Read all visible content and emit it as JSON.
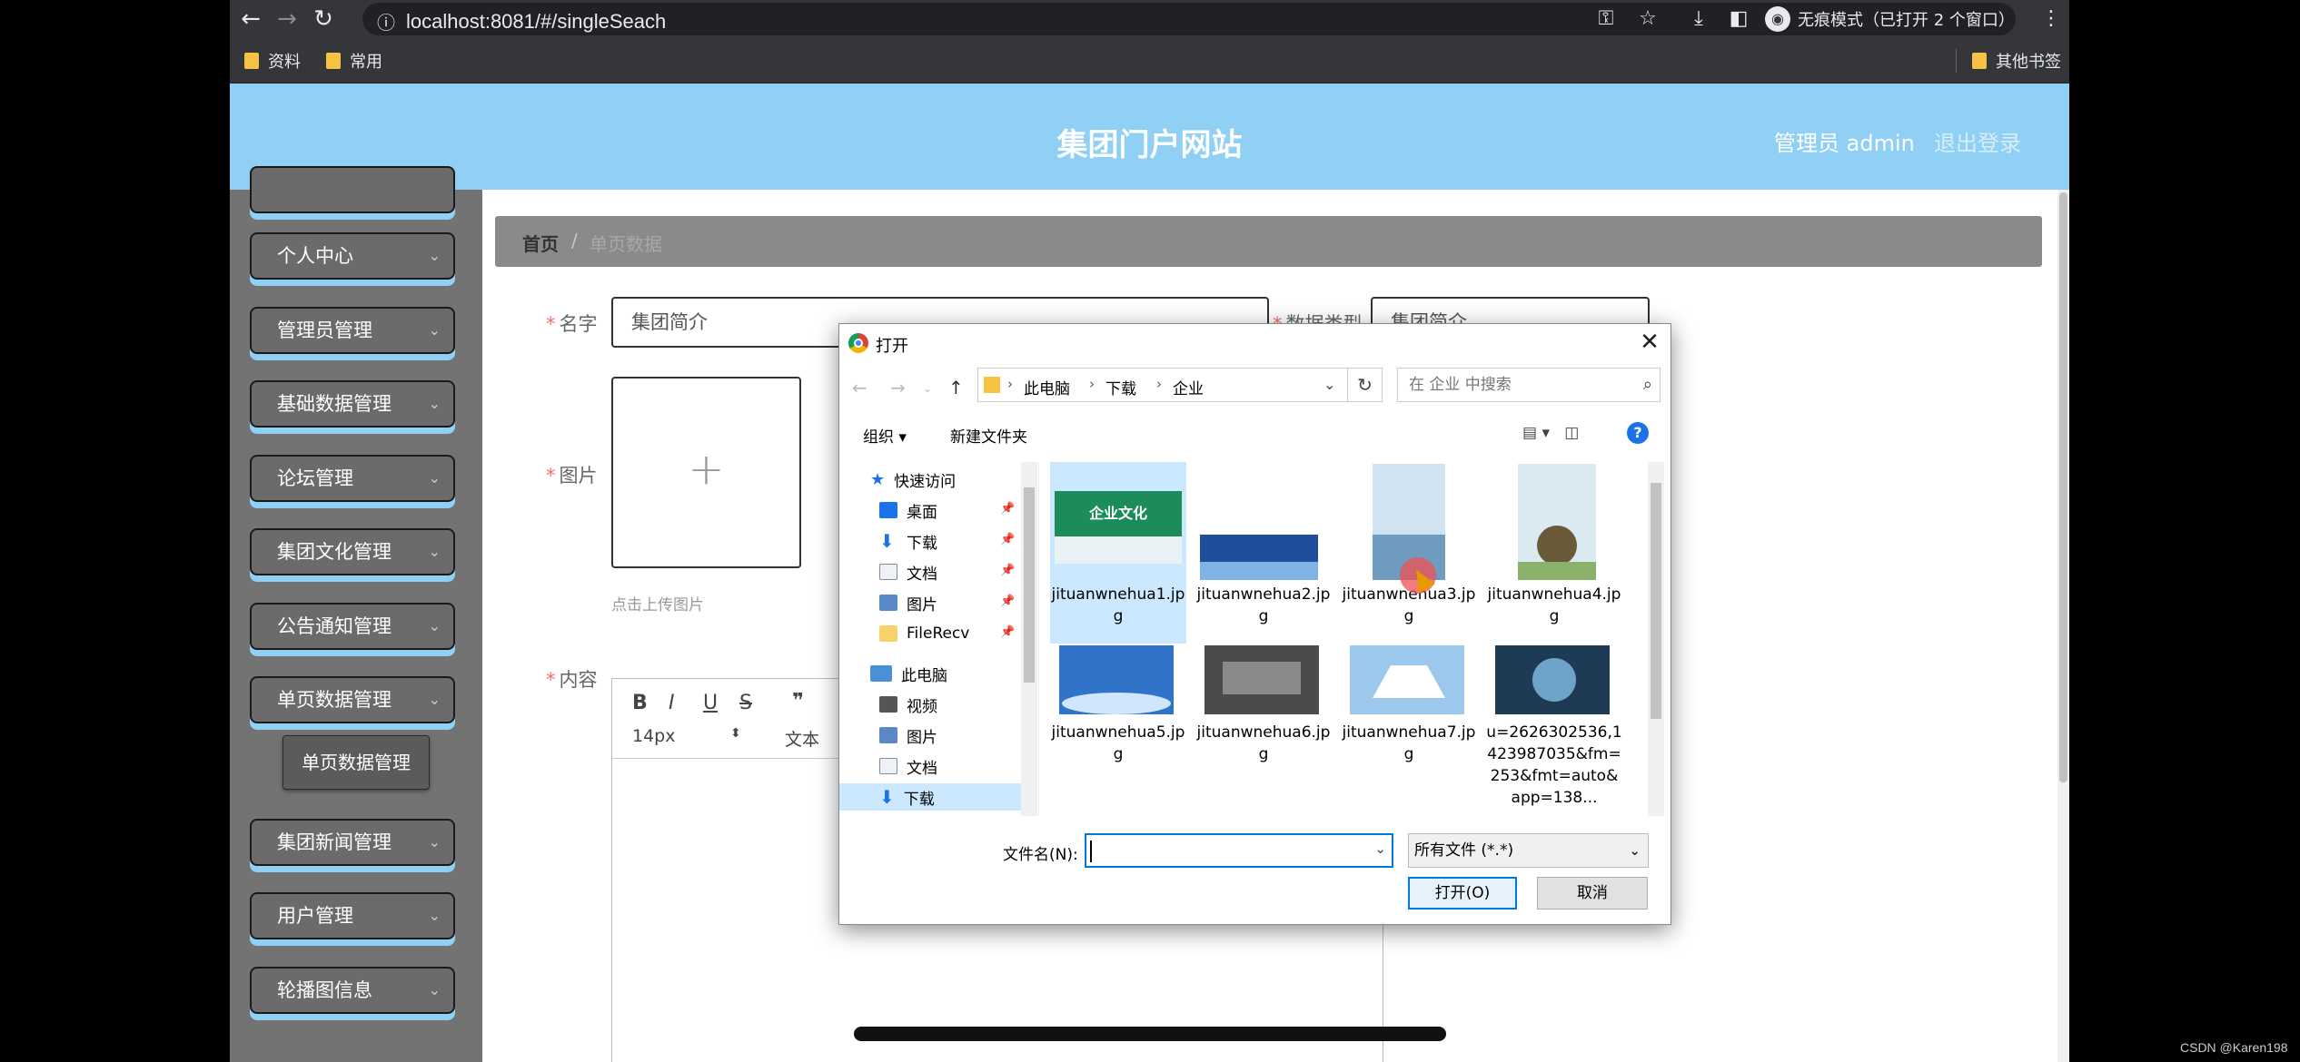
{
  "browser": {
    "url": "localhost:8081/#/singleSeach",
    "incognito_label": "无痕模式（已打开 2 个窗口）",
    "bookmarks": [
      "资料",
      "常用"
    ],
    "other_bookmarks": "其他书签"
  },
  "header": {
    "title": "集团门户网站",
    "admin_label": "管理员 admin",
    "logout_label": "退出登录"
  },
  "sidebar": {
    "items": [
      {
        "label": "个人中心"
      },
      {
        "label": "管理员管理"
      },
      {
        "label": "基础数据管理"
      },
      {
        "label": "论坛管理"
      },
      {
        "label": "集团文化管理"
      },
      {
        "label": "公告通知管理"
      },
      {
        "label": "单页数据管理"
      },
      {
        "label": "集团新闻管理"
      },
      {
        "label": "用户管理"
      },
      {
        "label": "轮播图信息"
      }
    ],
    "submenu_label": "单页数据管理"
  },
  "breadcrumb": {
    "home": "首页",
    "separator": "/",
    "current": "单页数据"
  },
  "form": {
    "name_label": "名字",
    "name_value": "集团简介",
    "type_label": "数据类型",
    "type_value": "集团简介",
    "image_label": "图片",
    "upload_hint": "点击上传图片",
    "content_label": "内容",
    "font_size": "14px",
    "text_style": "文本"
  },
  "dialog": {
    "title": "打开",
    "path": [
      "此电脑",
      "下载",
      "企业"
    ],
    "search_placeholder": "在 企业 中搜索",
    "organize": "组织 ▾",
    "new_folder": "新建文件夹",
    "tree": [
      {
        "label": "快速访问",
        "icon": "star-icon"
      },
      {
        "label": "桌面",
        "icon": "desktop-icon"
      },
      {
        "label": "下载",
        "icon": "download-icon"
      },
      {
        "label": "文档",
        "icon": "document-icon"
      },
      {
        "label": "图片",
        "icon": "picture-icon"
      },
      {
        "label": "FileRecv",
        "icon": "folder-icon"
      },
      {
        "label": "此电脑",
        "icon": "computer-icon"
      },
      {
        "label": "视频",
        "icon": "video-icon"
      },
      {
        "label": "图片",
        "icon": "picture-icon"
      },
      {
        "label": "文档",
        "icon": "document-icon"
      },
      {
        "label": "下载",
        "icon": "download-icon"
      }
    ],
    "files": [
      {
        "name": "jituanwnehua1.jpg",
        "thumb_text": "企业文化"
      },
      {
        "name": "jituanwnehua2.jpg"
      },
      {
        "name": "jituanwnehua3.jpg"
      },
      {
        "name": "jituanwnehua4.jpg"
      },
      {
        "name": "jituanwnehua5.jpg"
      },
      {
        "name": "jituanwnehua6.jpg"
      },
      {
        "name": "jituanwnehua7.jpg"
      },
      {
        "name": "u=2626302536,1423987035&fm=253&fmt=auto&app=138..."
      }
    ],
    "filename_label": "文件名(N):",
    "filename_value": "",
    "filetype": "所有文件 (*.*)",
    "open_button": "打开(O)",
    "cancel_button": "取消"
  },
  "watermark": "CSDN @Karen198",
  "colors": {
    "header": "#8fd0f4",
    "sidebar": "#737373",
    "accent": "#0078d7"
  }
}
